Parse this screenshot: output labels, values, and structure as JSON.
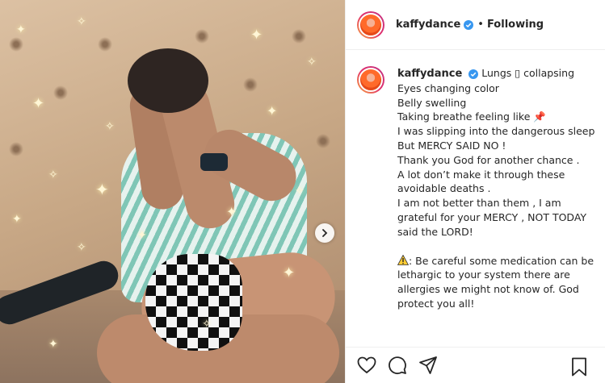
{
  "post": {
    "username": "kaffydance",
    "follow_state": "Following",
    "separator": "•",
    "caption_lines_1": [
      "Lungs ▯ collapsing",
      "Eyes changing color",
      "Belly swelling",
      "Taking breathe feeling like 📌",
      "I was slipping into the dangerous sleep",
      "But MERCY SAID NO !",
      "Thank you God for another chance .",
      "A lot don’t make it through these avoidable deaths .",
      "I am not better than them , I am grateful for your MERCY , NOT TODAY said the LORD!"
    ],
    "warning_text": ": Be careful some medication can be lethargic to your system there are allergies we might not know of. God protect you all!"
  },
  "icons": {
    "verified": "verified-badge-icon",
    "next": "chevron-right-icon",
    "like": "heart-icon",
    "comment": "comment-icon",
    "share": "send-icon",
    "save": "bookmark-icon",
    "warning": "warning-icon"
  },
  "colors": {
    "verified": "#3897f0",
    "text": "#262626",
    "border": "#efefef"
  }
}
